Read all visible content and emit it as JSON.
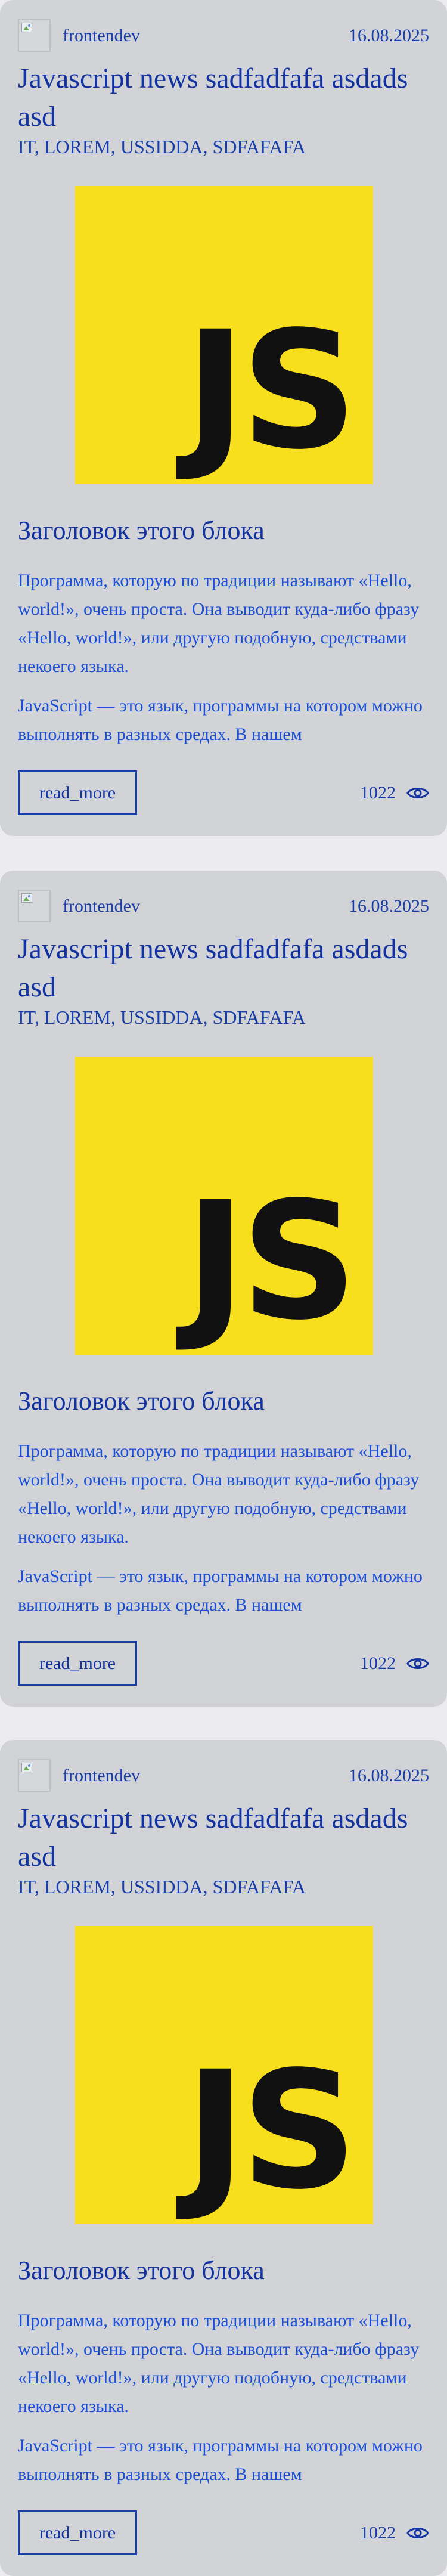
{
  "posts": [
    {
      "author": "frontendev",
      "date": "16.08.2025",
      "title": "Javascript news sadfadfafa asdads asd",
      "tags": "IT, LOREM, USSIDDA, SDFAFAFA",
      "image_text": "JS",
      "heading": "Заголовок этого блока",
      "paragraph_1": "Программа, которую по традиции называют «Hello, world!», очень проста. Она выводит куда-либо фразу «Hello, world!», или другую подобную, средствами некоего языка.",
      "paragraph_2": "JavaScript — это язык, программы на котором можно выполнять в разных средах. В нашем",
      "read_more_label": "read_more",
      "views": "1022",
      "views_icon": "eye-icon"
    },
    {
      "author": "frontendev",
      "date": "16.08.2025",
      "title": "Javascript news sadfadfafa asdads asd",
      "tags": "IT, LOREM, USSIDDA, SDFAFAFA",
      "image_text": "JS",
      "heading": "Заголовок этого блока",
      "paragraph_1": "Программа, которую по традиции называют «Hello, world!», очень проста. Она выводит куда-либо фразу «Hello, world!», или другую подобную, средствами некоего языка.",
      "paragraph_2": "JavaScript — это язык, программы на котором можно выполнять в разных средах. В нашем",
      "read_more_label": "read_more",
      "views": "1022",
      "views_icon": "eye-icon"
    },
    {
      "author": "frontendev",
      "date": "16.08.2025",
      "title": "Javascript news sadfadfafa asdads asd",
      "tags": "IT, LOREM, USSIDDA, SDFAFAFA",
      "image_text": "JS",
      "heading": "Заголовок этого блока",
      "paragraph_1": "Программа, которую по традиции называют «Hello, world!», очень проста. Она выводит куда-либо фразу «Hello, world!», или другую подобную, средствами некоего языка.",
      "paragraph_2": "JavaScript — это язык, программы на котором можно выполнять в разных средах. В нашем",
      "read_more_label": "read_more",
      "views": "1022",
      "views_icon": "eye-icon"
    }
  ],
  "colors": {
    "page_bg": "#ececee",
    "card_bg": "#d2d3d6",
    "text_link": "#1a3fa8",
    "text_body": "#1a4fd6",
    "js_yellow": "#f7df1e",
    "js_black": "#111111"
  }
}
